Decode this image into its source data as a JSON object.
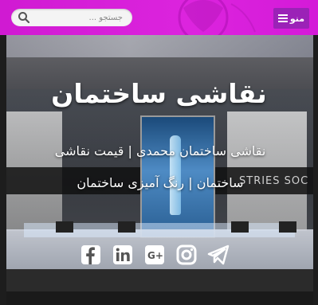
{
  "header": {
    "menu_label": "منو",
    "search_placeholder": "جستجو ..."
  },
  "hero": {
    "title": "نقاشی ساختمان",
    "description": "نقاشی ساختمان محمدی | قیمت نقاشی ساختمان | رنگ آمیزی ساختمان",
    "background_text": "STRIES SOC"
  },
  "social": [
    {
      "name": "facebook-icon"
    },
    {
      "name": "linkedin-icon"
    },
    {
      "name": "google-plus-icon"
    },
    {
      "name": "instagram-icon"
    },
    {
      "name": "telegram-icon"
    }
  ],
  "colors": {
    "header_bg": "#d61ed8",
    "menu_bg": "#9b22b7",
    "text": "#ffffff"
  }
}
